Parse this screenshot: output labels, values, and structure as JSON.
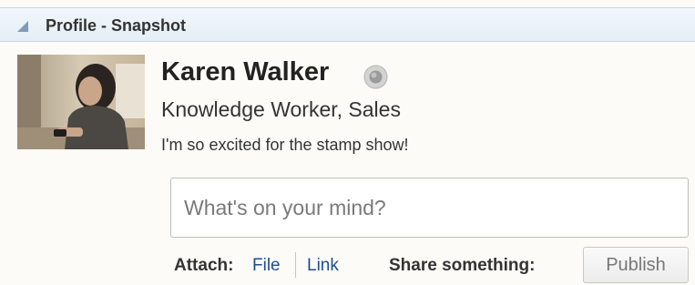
{
  "panel": {
    "title": "Profile - Snapshot",
    "collapse_icon": "collapse-triangle-icon"
  },
  "profile": {
    "name": "Karen Walker",
    "presence_icon": "presence-status-icon",
    "role": "Knowledge Worker, Sales",
    "status_message": "I'm so excited for the stamp show!"
  },
  "composer": {
    "placeholder": "What's on your mind?",
    "attach_label": "Attach:",
    "attach_file_label": "File",
    "attach_link_label": "Link",
    "share_label": "Share something:",
    "publish_label": "Publish"
  },
  "colors": {
    "link": "#1f4e8c",
    "header_background": "#e4eef6",
    "panel_background": "#fcfbf7"
  }
}
